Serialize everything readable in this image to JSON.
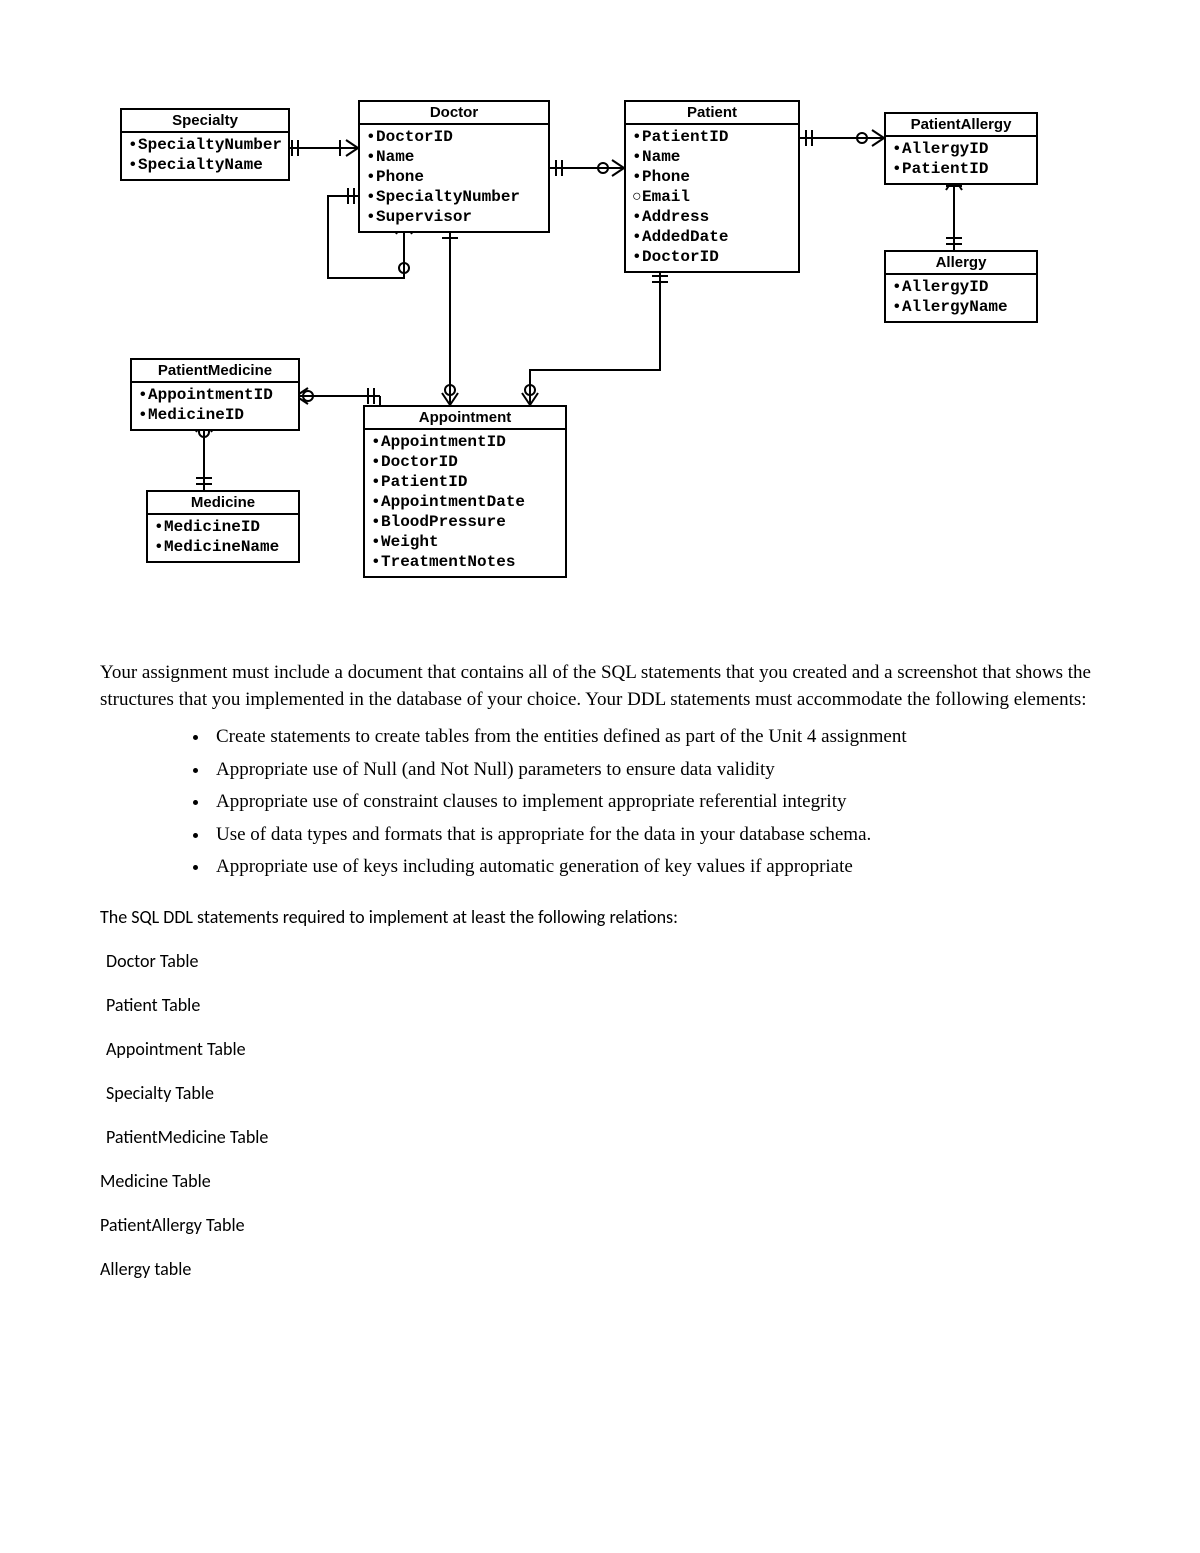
{
  "entities": {
    "specialty": {
      "title": "Specialty",
      "attrs": [
        "SpecialtyNumber",
        "SpecialtyName"
      ]
    },
    "doctor": {
      "title": "Doctor",
      "attrs": [
        "DoctorID",
        "Name",
        "Phone",
        "SpecialtyNumber",
        "Supervisor"
      ]
    },
    "patient": {
      "title": "Patient",
      "attrs": [
        "PatientID",
        "Name",
        "Phone",
        "Email",
        "Address",
        "AddedDate",
        "DoctorID"
      ]
    },
    "patientallergy": {
      "title": "PatientAllergy",
      "attrs": [
        "AllergyID",
        "PatientID"
      ]
    },
    "allergy": {
      "title": "Allergy",
      "attrs": [
        "AllergyID",
        "AllergyName"
      ]
    },
    "patientmedicine": {
      "title": "PatientMedicine",
      "attrs": [
        "AppointmentID",
        "MedicineID"
      ]
    },
    "medicine": {
      "title": "Medicine",
      "attrs": [
        "MedicineID",
        "MedicineName"
      ]
    },
    "appointment": {
      "title": "Appointment",
      "attrs": [
        "AppointmentID",
        "DoctorID",
        "PatientID",
        "AppointmentDate",
        "BloodPressure",
        "Weight",
        "TreatmentNotes"
      ]
    }
  },
  "paragraph1": "Your assignment must include a document that contains all of the SQL statements that you created and a screenshot that shows the structures that you implemented in the database of your choice. Your DDL statements must accommodate the following elements:",
  "bullets": [
    "Create statements to create tables from the entities defined as part of the Unit 4 assignment",
    "Appropriate use of Null (and Not Null) parameters to ensure data validity",
    "Appropriate use of constraint clauses to implement appropriate referential integrity",
    "Use of data types and formats that is appropriate for the data in your database schema.",
    "Appropriate use of keys including automatic generation of key values if appropriate"
  ],
  "relations_intro": "The SQL DDL statements required to implement at least the following relations:",
  "tables_list": [
    "Doctor Table",
    "Patient Table",
    "Appointment Table",
    "Specialty Table",
    "PatientMedicine Table",
    "Medicine Table",
    "PatientAllergy Table",
    "Allergy table"
  ]
}
